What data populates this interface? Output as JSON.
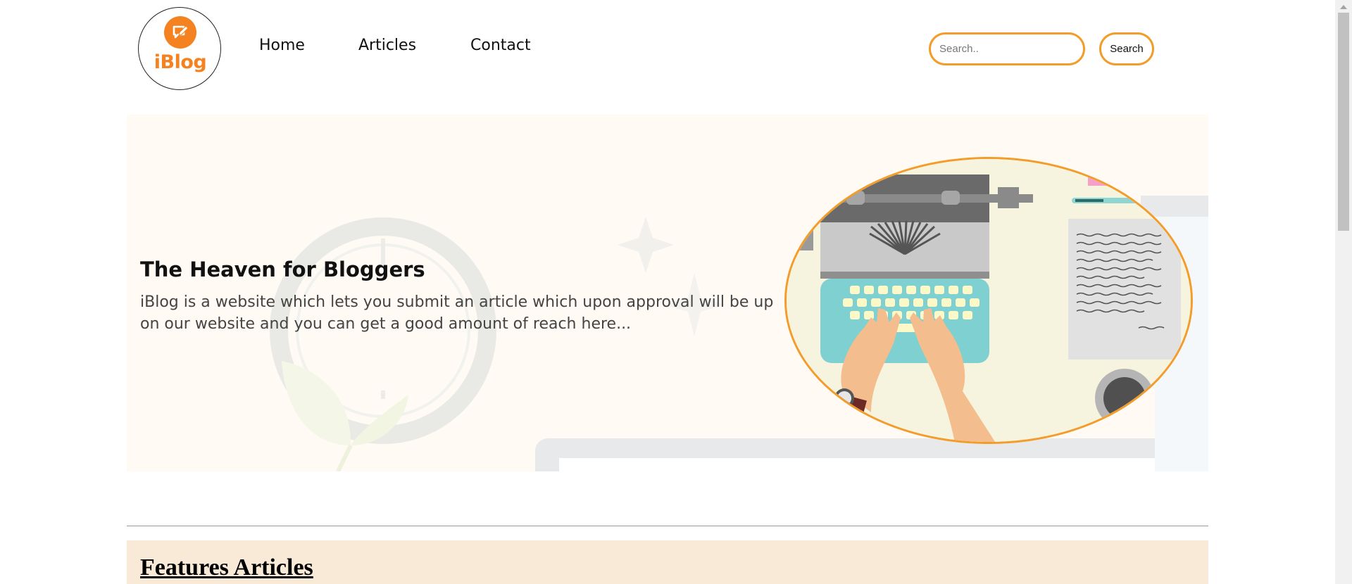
{
  "brand": {
    "logo_text": "iBlog",
    "accent": "#f58220"
  },
  "nav": {
    "items": [
      {
        "label": "Home"
      },
      {
        "label": "Articles"
      },
      {
        "label": "Contact"
      }
    ]
  },
  "search": {
    "placeholder": "Search..",
    "button_label": "Search"
  },
  "hero": {
    "title": "The Heaven for Bloggers",
    "description": "iBlog is a website which lets you submit an article which upon approval will be up on our website and you can get a good amount of reach here...",
    "background": "#fffaf3"
  },
  "featured": {
    "title": "Features Articles",
    "background": "#f9ead8"
  },
  "icons": {
    "logo": "chat-edit-icon",
    "illustration": "typewriter-illustration"
  }
}
